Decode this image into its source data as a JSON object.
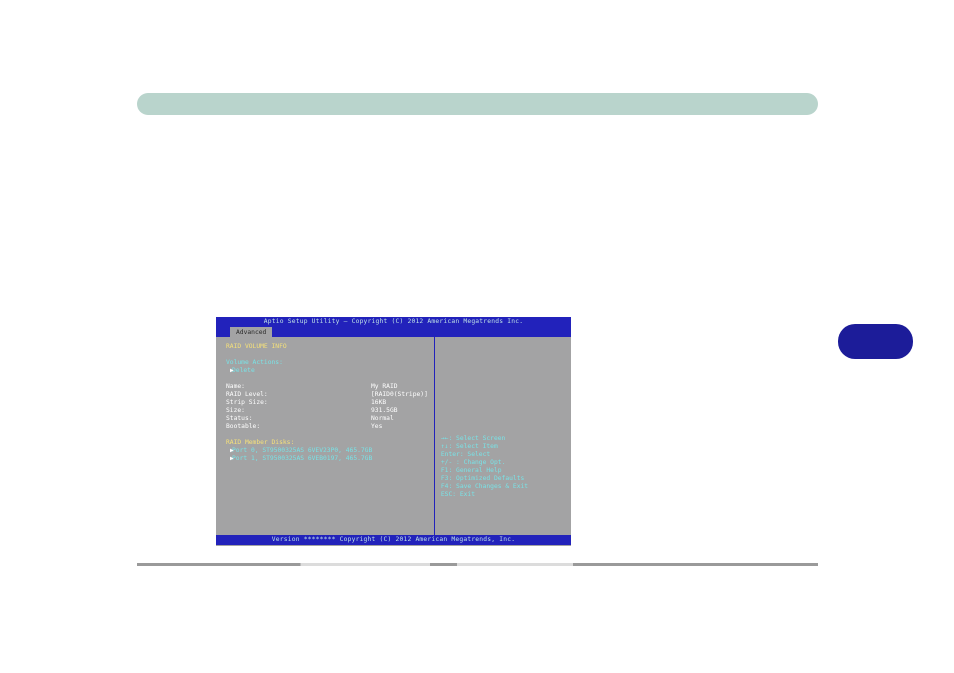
{
  "bios": {
    "header": "Aptio Setup Utility – Copyright (C) 2012 American Megatrends Inc.",
    "footer": "Version ******** Copyright (C) 2012 American Megatrends, Inc.",
    "tab": "Advanced",
    "heading": "RAID VOLUME INFO",
    "actions_label": "Volume Actions:",
    "delete": "Delete",
    "info": {
      "name_label": "Name:",
      "name_value": "My RAID",
      "level_label": "RAID Level:",
      "level_value": "[RAID0(Stripe)]",
      "strip_label": "Strip Size:",
      "strip_value": "16KB",
      "size_label": "Size:",
      "size_value": "931.5GB",
      "status_label": "Status:",
      "status_value": "Normal",
      "bootable_label": "Bootable:",
      "bootable_value": "Yes"
    },
    "members_label": "RAID Member Disks:",
    "member0": "Port 0, ST9500325AS 6VEV23P0, 465.7GB",
    "member1": "Port 1, ST9500325AS 6VEB0197, 465.7GB",
    "help": {
      "l1": "→←: Select Screen",
      "l2": "↑↓: Select Item",
      "l3": "Enter: Select",
      "l4": "+/- : Change Opt.",
      "l5": "F1: General Help",
      "l6": "F3: Optimized Defaults",
      "l7": "F4: Save Changes & Exit",
      "l8": "ESC: Exit"
    }
  }
}
